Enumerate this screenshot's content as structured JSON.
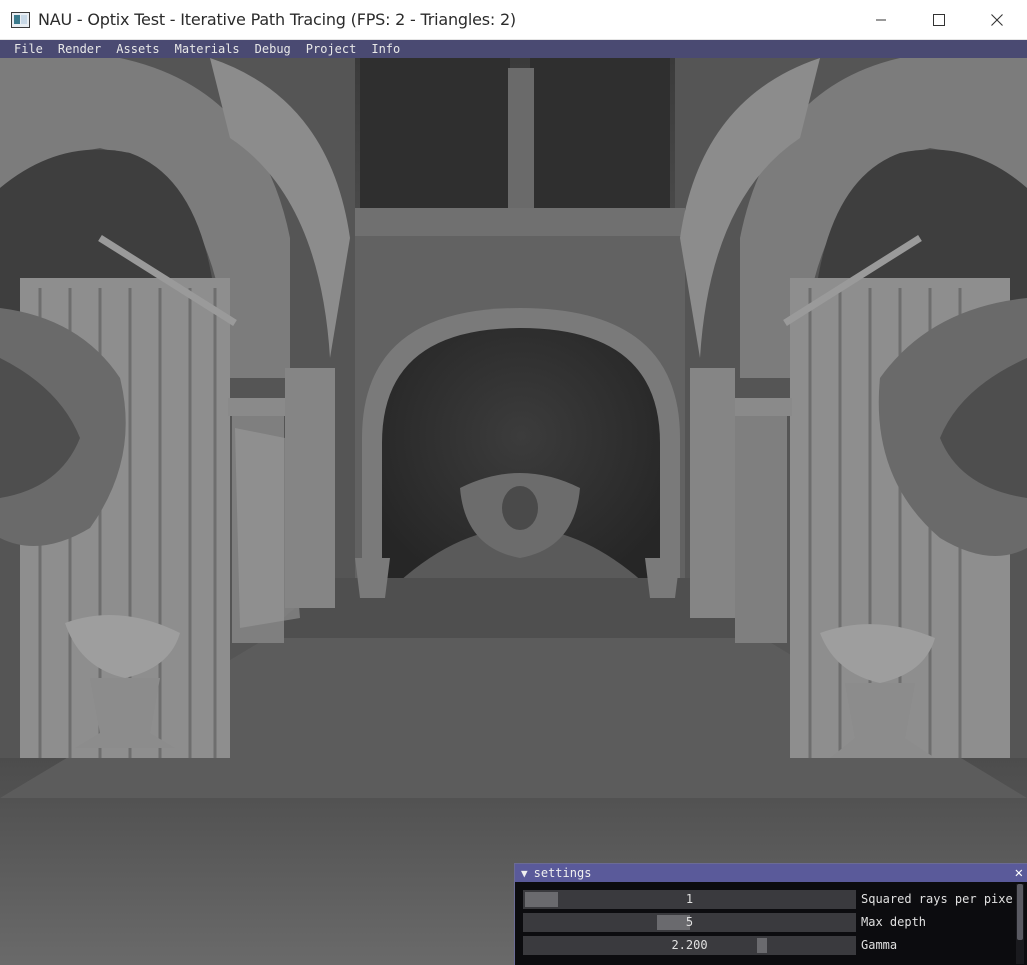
{
  "window": {
    "title": "NAU - Optix Test - Iterative Path Tracing (FPS: 2 - Triangles: 2)",
    "icon": "app-window-icon"
  },
  "menu": {
    "items": [
      "File",
      "Render",
      "Assets",
      "Materials",
      "Debug",
      "Project",
      "Info"
    ]
  },
  "viewport": {
    "description_color": "#545454"
  },
  "settings": {
    "title": "settings",
    "collapse_glyph": "▼",
    "close_glyph": "✕",
    "rows": [
      {
        "value": "1",
        "label": "Squared rays per pixel",
        "fraction": 0.02
      },
      {
        "value": "5",
        "label": "Max depth",
        "fraction": 0.45
      },
      {
        "value": "2.200",
        "label": "Gamma",
        "fraction": 0.72
      }
    ]
  },
  "colors": {
    "menubar": "#4a4a72",
    "settings_header": "#5a5a9a",
    "panel_bg": "#0c0c0f"
  }
}
